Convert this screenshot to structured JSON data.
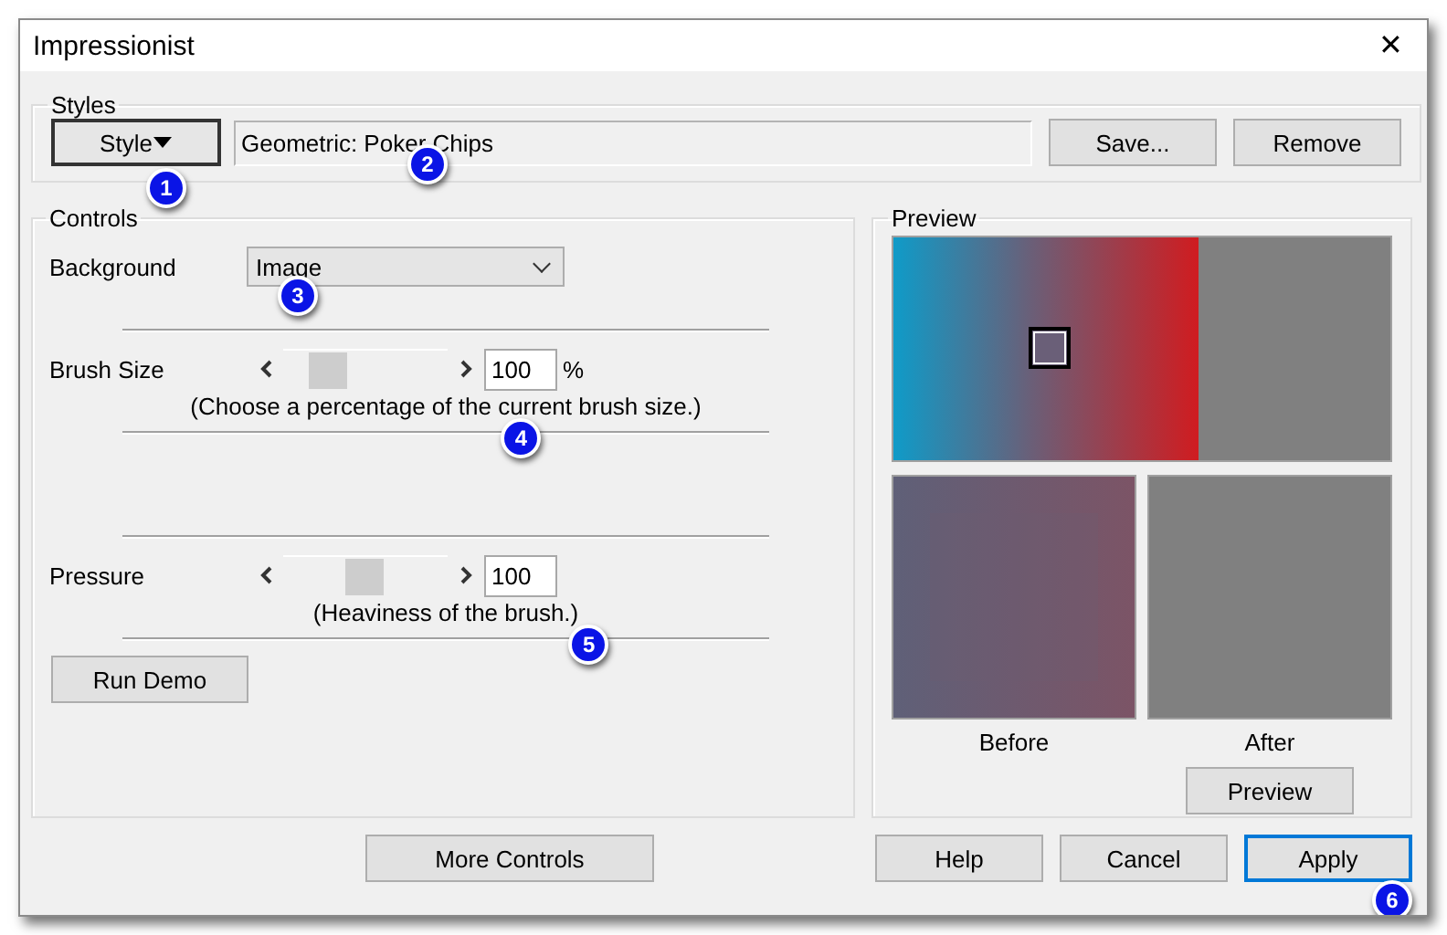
{
  "window": {
    "title": "Impressionist",
    "close": "✕"
  },
  "styles": {
    "label": "Styles",
    "style_button": {
      "label": "Style",
      "callout": "1"
    },
    "style_field": {
      "value": "Geometric: Poker Chips",
      "callout": "2"
    },
    "buttons": [
      "Save...",
      "Remove"
    ]
  },
  "controls": {
    "label": "Controls",
    "background": {
      "label": "Background",
      "value": "Image",
      "callout": "3"
    },
    "sliders": [
      {
        "label": "Brush Size",
        "level": 0.2,
        "value": "100",
        "unit": "%",
        "hint": "(Choose a percentage of the current brush size.)",
        "callout": "4"
      },
      {
        "label": "Pressure",
        "level": 0.49,
        "value": "100",
        "hint": "(Heaviness of the brush.)",
        "callout": "5"
      }
    ],
    "run_demo": "Run Demo"
  },
  "preview": {
    "label": "Preview",
    "before": "Before",
    "after": "After",
    "button": "Preview"
  },
  "footer": {
    "more": "More Controls",
    "buttons": [
      {
        "label": "Help",
        "default": false
      },
      {
        "label": "Cancel",
        "default": false
      },
      {
        "label": "Apply",
        "default": true,
        "callout": "6"
      }
    ]
  }
}
